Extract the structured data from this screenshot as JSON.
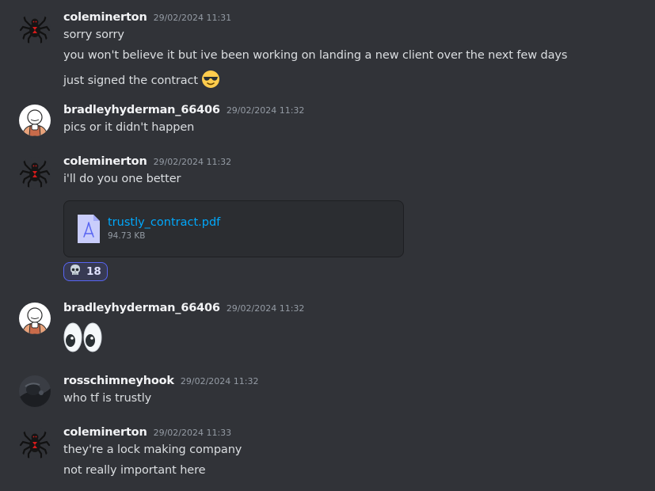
{
  "messages": [
    {
      "username": "coleminerton",
      "timestamp": "29/02/2024 11:31",
      "avatar_icon": "spider-avatar-icon",
      "lines": [
        "sorry sorry",
        "you won't believe it but ive been working on landing a new client over the next few days",
        "just signed the contract"
      ],
      "inline_emoji": "sunglasses-emoji"
    },
    {
      "username": "bradleyhyderman_66406",
      "timestamp": "29/02/2024 11:32",
      "avatar_icon": "cartoon-person-avatar-icon",
      "lines": [
        "pics or it didn't happen"
      ]
    },
    {
      "username": "coleminerton",
      "timestamp": "29/02/2024 11:32",
      "avatar_icon": "spider-avatar-icon",
      "lines": [
        "i'll do you one better"
      ],
      "attachment": {
        "file_name": "trustly_contract.pdf",
        "file_size": "94.73 KB",
        "icon": "pdf-file-icon"
      },
      "reaction": {
        "emoji": "skull-emoji",
        "count": "18"
      }
    },
    {
      "username": "bradleyhyderman_66406",
      "timestamp": "29/02/2024 11:32",
      "avatar_icon": "cartoon-person-avatar-icon",
      "jumbo_emoji": "eyes-emoji"
    },
    {
      "username": "rosschimneyhook",
      "timestamp": "29/02/2024 11:32",
      "avatar_icon": "dark-photo-avatar-icon",
      "lines": [
        "who tf is trustly"
      ]
    },
    {
      "username": "coleminerton",
      "timestamp": "29/02/2024 11:33",
      "avatar_icon": "spider-avatar-icon",
      "lines": [
        "they're a lock making company",
        "not really important here"
      ]
    }
  ],
  "colors": {
    "background": "#313338",
    "username": "#f2f3f5",
    "text": "#dbdee1",
    "timestamp": "#949ba4",
    "link": "#00a8fc",
    "reaction_border": "#5865f2"
  }
}
